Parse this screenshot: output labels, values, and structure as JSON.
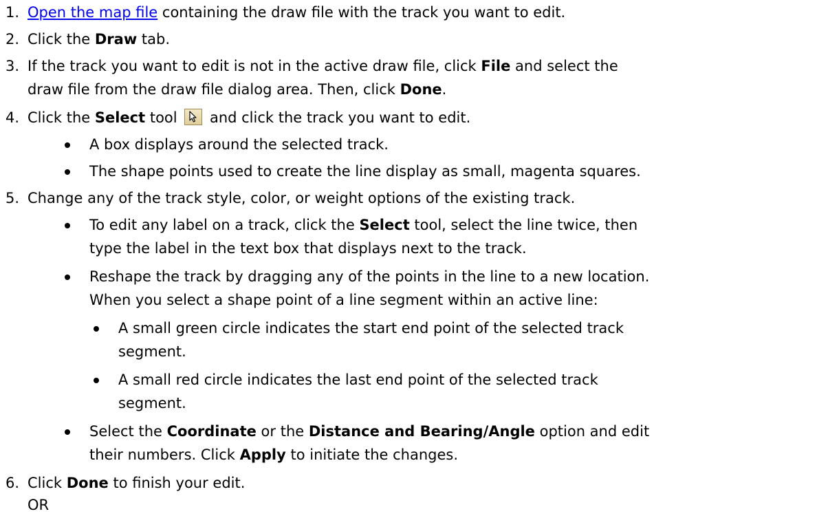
{
  "steps": [
    {
      "number": "1.",
      "link_text": "Open the map file",
      "text_after": " containing the draw file with the track you want to edit."
    },
    {
      "number": "2.",
      "text_before": "Click the ",
      "bold": "Draw",
      "text_after": " tab."
    },
    {
      "number": "3.",
      "line1_before": "If the track you want to edit is not in the active draw file, click ",
      "line1_bold": "File",
      "line1_after": " and select the",
      "line2_before": "draw file from the draw file dialog area. Then, click ",
      "line2_bold": "Done",
      "line2_after": "."
    },
    {
      "number": "4.",
      "text_before": "Click the ",
      "bold": "Select",
      "text_middle": " tool ",
      "text_after": " and click the track you want to edit.",
      "icon": "select-arrow-icon",
      "bullets": [
        "A box displays around the selected track.",
        "The shape points used to create the line display as small, magenta squares."
      ]
    },
    {
      "number": "5.",
      "text": "Change any of the track style, color, or weight options of the existing track.",
      "bullet1_line1_before": "To edit any label on a track, click the ",
      "bullet1_line1_bold": "Select",
      "bullet1_line1_after": " tool, select the line twice, then",
      "bullet1_line2": "type the label in the text box that displays next to the track.",
      "bullet2_line1": "Reshape the track by dragging any of the points in the line to a new location.",
      "bullet2_line2": "When you select a shape point of a line segment within an active line:",
      "sub1_line1": "A small green circle indicates the start end point of the selected track",
      "sub1_line2": "segment.",
      "sub2_line1": "A small red circle indicates the last end point of the selected track",
      "sub2_line2": "segment.",
      "bullet3_line1_a": "Select the ",
      "bullet3_line1_b": "Coordinate",
      "bullet3_line1_c": " or the ",
      "bullet3_line1_d": "Distance and Bearing/Angle",
      "bullet3_line1_e": " option and edit",
      "bullet3_line2_a": "their numbers. Click ",
      "bullet3_line2_b": "Apply",
      "bullet3_line2_c": " to initiate the changes."
    },
    {
      "number": "6.",
      "text_before": "Click ",
      "bold": "Done",
      "text_after": " to finish your edit.",
      "or_text": "OR"
    }
  ],
  "colors": {
    "link": "#0000ee",
    "text": "#000000",
    "background": "#ffffff"
  }
}
